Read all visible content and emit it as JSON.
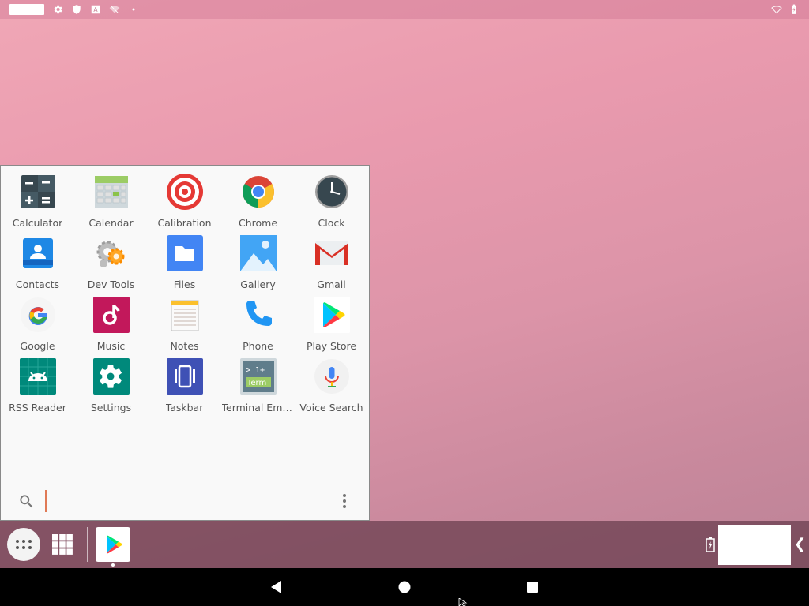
{
  "status_bar": {
    "left_icons": [
      "settings-icon",
      "shield-icon",
      "keyboard-a-icon",
      "wifi-off-icon",
      "dot-icon"
    ],
    "right_icons": [
      "wifi-icon",
      "battery-icon"
    ]
  },
  "start_menu": {
    "apps": [
      {
        "label": "Calculator",
        "icon": "calculator-icon"
      },
      {
        "label": "Calendar",
        "icon": "calendar-icon"
      },
      {
        "label": "Calibration",
        "icon": "calibration-icon"
      },
      {
        "label": "Chrome",
        "icon": "chrome-icon"
      },
      {
        "label": "Clock",
        "icon": "clock-icon"
      },
      {
        "label": "Contacts",
        "icon": "contacts-icon"
      },
      {
        "label": "Dev Tools",
        "icon": "dev-tools-icon"
      },
      {
        "label": "Files",
        "icon": "files-icon"
      },
      {
        "label": "Gallery",
        "icon": "gallery-icon"
      },
      {
        "label": "Gmail",
        "icon": "gmail-icon"
      },
      {
        "label": "Google",
        "icon": "google-icon"
      },
      {
        "label": "Music",
        "icon": "music-icon"
      },
      {
        "label": "Notes",
        "icon": "notes-icon"
      },
      {
        "label": "Phone",
        "icon": "phone-icon"
      },
      {
        "label": "Play Store",
        "icon": "play-store-icon"
      },
      {
        "label": "RSS Reader",
        "icon": "rss-reader-icon"
      },
      {
        "label": "Settings",
        "icon": "settings-icon"
      },
      {
        "label": "Taskbar",
        "icon": "taskbar-icon"
      },
      {
        "label": "Terminal Emu...",
        "icon": "terminal-icon"
      },
      {
        "label": "Voice Search",
        "icon": "voice-search-icon"
      }
    ],
    "terminal_icon_text": {
      "line1": "> 1+",
      "line2": "Term"
    },
    "search": {
      "value": "",
      "placeholder": ""
    }
  },
  "taskbar": {
    "pinned": [
      {
        "icon": "play-store-icon"
      }
    ]
  },
  "colors": {
    "accent": "#e07a56",
    "menu_bg": "#f9f9f9",
    "taskbar_bg": "#6e4152",
    "nav_bg": "#000000"
  }
}
